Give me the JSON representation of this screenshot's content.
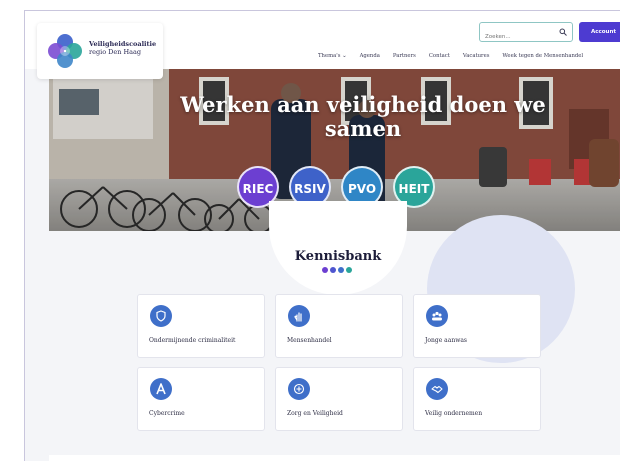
{
  "header": {
    "logo_line1": "Veiligheidscoalitie",
    "logo_line2": "regio Den Haag",
    "search_placeholder": "Zoeken...",
    "account_label": "Account",
    "nav": [
      "Thema's ⌄",
      "Agenda",
      "Partners",
      "Contact",
      "Vacatures",
      "Week tegen de Mensenhandel"
    ]
  },
  "hero": {
    "title": "Werken aan veiligheid doen we samen",
    "badges": [
      {
        "label": "RIEC",
        "color": "#6c3fd1"
      },
      {
        "label": "RSIV",
        "color": "#3e62c9"
      },
      {
        "label": "PVO",
        "color": "#2f86c6"
      },
      {
        "label": "HEIT",
        "color": "#2aa59a"
      }
    ]
  },
  "kennisbank": {
    "title": "Kennisbank",
    "dot_colors": [
      "#6c3fd1",
      "#4e55cf",
      "#3f6fc9",
      "#2aa59a"
    ],
    "cards": [
      {
        "label": "Ondermijnende criminaliteit",
        "icon": "shield-icon"
      },
      {
        "label": "Mensenhandel",
        "icon": "hand-icon"
      },
      {
        "label": "Jonge aanwas",
        "icon": "group-icon"
      },
      {
        "label": "Cybercrime",
        "icon": "cyber-icon"
      },
      {
        "label": "Zorg en Veiligheid",
        "icon": "care-icon"
      },
      {
        "label": "Veilig ondernemen",
        "icon": "handshake-icon"
      }
    ]
  }
}
